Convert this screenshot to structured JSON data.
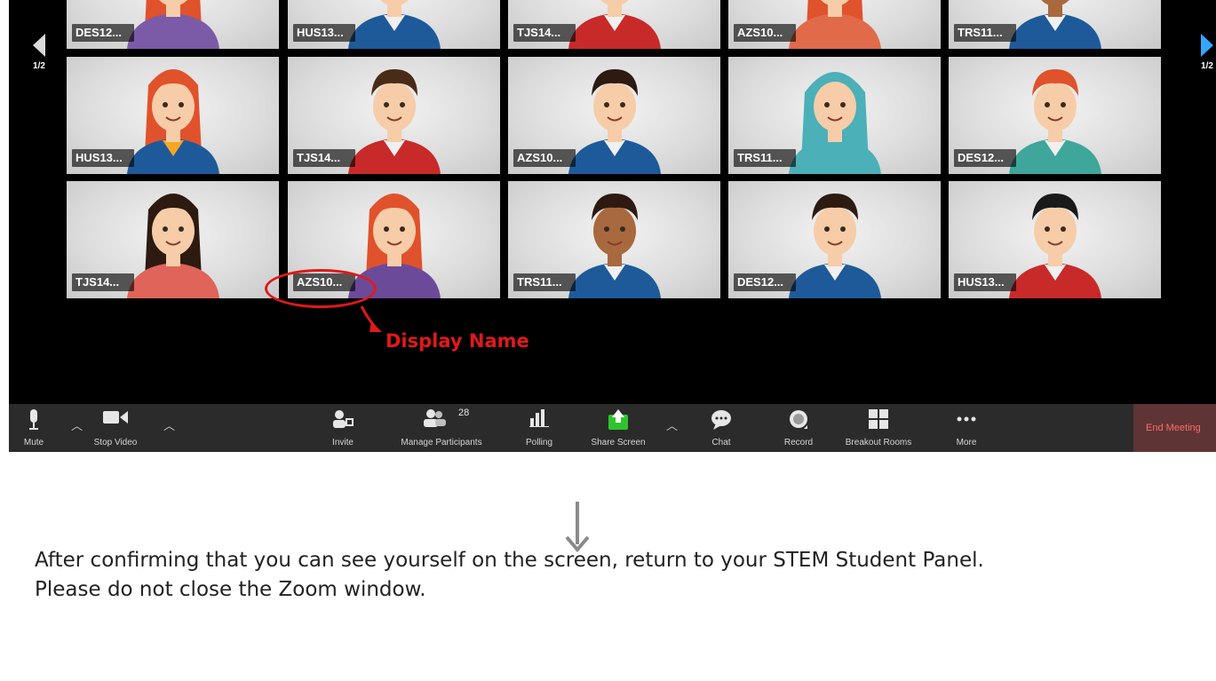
{
  "gallery": {
    "page_left": "1/2",
    "page_right": "1/2",
    "tiles": [
      {
        "name": "DES12...",
        "hair": "#e0522b",
        "skin": "#f6cda8",
        "shirt": "#7b5aa8",
        "accent": "#7b5aa8",
        "style": "long"
      },
      {
        "name": "HUS13...",
        "hair": "#4a2b18",
        "skin": "#f6cda8",
        "shirt": "#1e5a9a",
        "accent": "#f0f0f0",
        "style": "short"
      },
      {
        "name": "TJS14...",
        "hair": "#4a2b18",
        "skin": "#f6cda8",
        "shirt": "#c82a2a",
        "accent": "#f0f0f0",
        "style": "short"
      },
      {
        "name": "AZS10...",
        "hair": "#e0522b",
        "skin": "#f6cda8",
        "shirt": "#e06a4a",
        "accent": "#e06a4a",
        "style": "long"
      },
      {
        "name": "TRS11...",
        "hair": "#2d1a10",
        "skin": "#a8693f",
        "shirt": "#1e5a9a",
        "accent": "#f0f0f0",
        "style": "short"
      },
      {
        "name": "HUS13...",
        "hair": "#e0522b",
        "skin": "#f6cda8",
        "shirt": "#1e5a9a",
        "accent": "#f5a623",
        "style": "long"
      },
      {
        "name": "TJS14...",
        "hair": "#4a2b18",
        "skin": "#f6cda8",
        "shirt": "#c82a2a",
        "accent": "#f0f0f0",
        "style": "short"
      },
      {
        "name": "AZS10...",
        "hair": "#2d1a10",
        "skin": "#f6cda8",
        "shirt": "#1e5a9a",
        "accent": "#f0f0f0",
        "style": "short"
      },
      {
        "name": "TRS11...",
        "hair": "#4bb0b8",
        "skin": "#f6cda8",
        "shirt": "#4bb0b8",
        "accent": "#4bb0b8",
        "style": "hijab"
      },
      {
        "name": "DES12...",
        "hair": "#e0522b",
        "skin": "#f6cda8",
        "shirt": "#3ea69a",
        "accent": "#f0f0f0",
        "style": "short"
      },
      {
        "name": "TJS14...",
        "hair": "#2d1a10",
        "skin": "#f6cda8",
        "shirt": "#e0645a",
        "accent": "#e0645a",
        "style": "long"
      },
      {
        "name": "AZS10...",
        "hair": "#e0522b",
        "skin": "#f6cda8",
        "shirt": "#6c4a9a",
        "accent": "#6c4a9a",
        "style": "long"
      },
      {
        "name": "TRS11...",
        "hair": "#2d1a10",
        "skin": "#a8693f",
        "shirt": "#1e5a9a",
        "accent": "#f0f0f0",
        "style": "short"
      },
      {
        "name": "DES12...",
        "hair": "#2d1a10",
        "skin": "#f6cda8",
        "shirt": "#1e5a9a",
        "accent": "#f0f0f0",
        "style": "short"
      },
      {
        "name": "HUS13...",
        "hair": "#1a1a1a",
        "skin": "#f6cda8",
        "shirt": "#c82a2a",
        "accent": "#f0f0f0",
        "style": "short"
      }
    ]
  },
  "annotation": {
    "label": "Display Name",
    "color": "#e01919"
  },
  "toolbar": {
    "mute": "Mute",
    "stop_video": "Stop Video",
    "invite": "Invite",
    "manage_participants": "Manage Participants",
    "participant_count": "28",
    "polling": "Polling",
    "share_screen": "Share Screen",
    "chat": "Chat",
    "record": "Record",
    "breakout_rooms": "Breakout Rooms",
    "more": "More",
    "end_meeting": "End Meeting"
  },
  "instructions": {
    "line1": "After confirming that you can see yourself on the screen, return to your STEM Student Panel.",
    "line2": "Please do not close the Zoom window."
  },
  "colors": {
    "share_green": "#2fc42f",
    "end_red": "#ff6b6b",
    "toolbar_bg": "#2b2b2b"
  }
}
